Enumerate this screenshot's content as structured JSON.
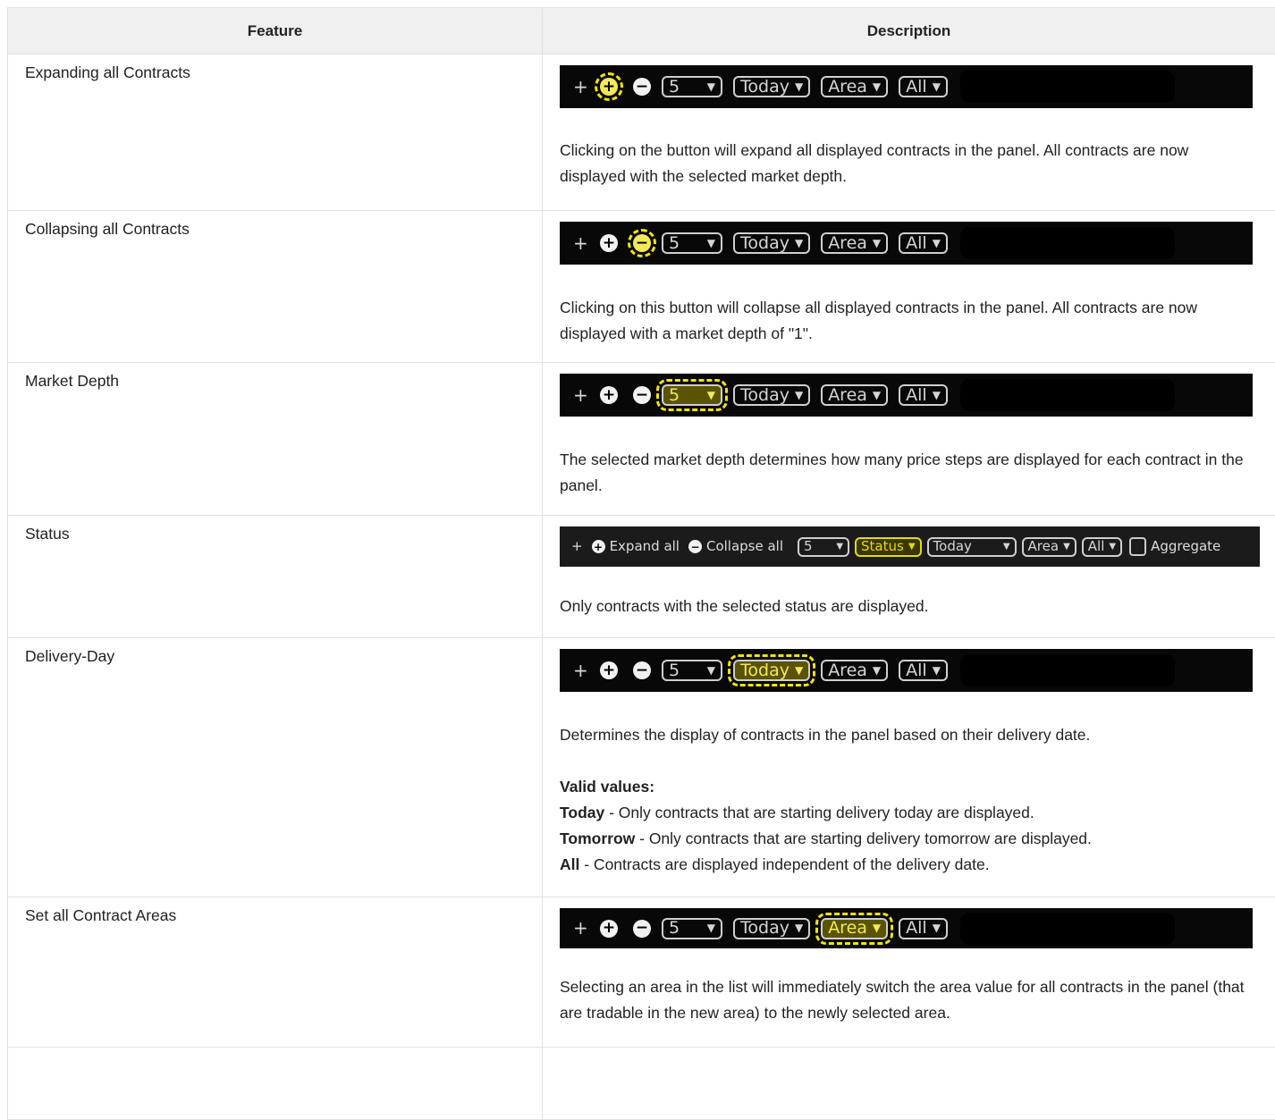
{
  "table": {
    "headers": {
      "feature": "Feature",
      "description": "Description"
    },
    "rows": [
      {
        "feature": "Expanding all Contracts",
        "paragraphs": [
          "Clicking on the button will expand all displayed contracts in the panel. All contracts are now displayed with the selected market depth."
        ]
      },
      {
        "feature": "Collapsing all Contracts",
        "paragraphs": [
          "Clicking on this button will collapse all displayed contracts in the panel. All contracts are now displayed with a market depth of \"1\"."
        ]
      },
      {
        "feature": "Market Depth",
        "paragraphs": [
          "The selected market depth determines how many price steps are displayed for each contract in the panel."
        ]
      },
      {
        "feature": "Status",
        "paragraphs": [
          "Only contracts with the selected status are displayed."
        ]
      },
      {
        "feature": "Delivery-Day",
        "paragraphs": [
          "Determines the display of contracts in the panel based on their delivery date."
        ],
        "valid_values_label": "Valid values:",
        "values": [
          {
            "term": "Today",
            "text": " - Only contracts that are starting delivery today are displayed."
          },
          {
            "term": "Tomorrow",
            "text": " - Only contracts that are starting delivery tomorrow are displayed."
          },
          {
            "term": "All",
            "text": " - Contracts are displayed independent of the delivery date."
          }
        ]
      },
      {
        "feature": "Set all Contract Areas",
        "paragraphs": [
          "Selecting an area in the list will immediately switch the area value for all contracts in the panel (that are tradable in the new area) to the newly selected area."
        ]
      }
    ]
  },
  "toolbar": {
    "plus": "+",
    "expand_glyph": "+",
    "collapse_glyph": "−",
    "depth_value": "5",
    "delivery_value": "Today",
    "area_value": "Area",
    "all_value": "All",
    "dropdown_arrow": "▼"
  },
  "toolbar_status": {
    "expand_label": "Expand all",
    "collapse_label": "Collapse all",
    "depth_value": "5",
    "status_value": "Status",
    "delivery_value": "Today",
    "area_value": "Area",
    "all_value": "All",
    "aggregate_label": "Aggregate"
  },
  "colors": {
    "highlight": "#f5e400",
    "toolbar_bg": "#080808",
    "header_bg": "#f0f0f0",
    "border": "#e1e1e1"
  }
}
